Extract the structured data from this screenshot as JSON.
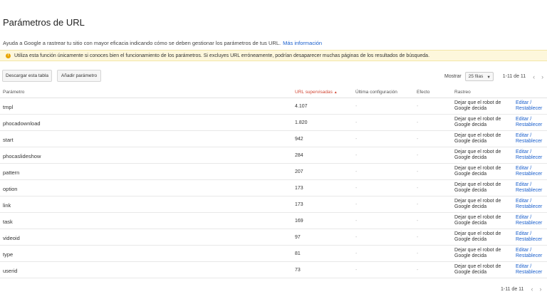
{
  "page": {
    "title": "Parámetros de URL",
    "intro": "Ayuda a Google a rastrear tu sitio con mayor eficacia indicando cómo se deben gestionar los parámetros de tus URL.",
    "more_info": "Más información",
    "warning": "Utiliza esta función únicamente si conoces bien el funcionamiento de los parámetros. Si excluyes URL erróneamente, podrían desaparecer muchas páginas de los resultados de búsqueda.",
    "warning_icon": "info-icon"
  },
  "toolbar": {
    "download_label": "Descargar esta tabla",
    "add_label": "Añadir parámetro",
    "show_label": "Mostrar",
    "rows_select": "25 filas",
    "range": "1-11 de 11"
  },
  "table": {
    "headers": {
      "param": "Parámetro",
      "urls": "URL supervisadas",
      "sort_indicator": "▲",
      "config": "Última configuración",
      "effect": "Efecto",
      "track": "Rastreo"
    },
    "rows": [
      {
        "param": "tmpl",
        "urls": "4.107",
        "config": "-",
        "effect": "-",
        "track": "Dejar que el robot de Google decida",
        "action": "Editar / Restablecer"
      },
      {
        "param": "phocadownload",
        "urls": "1.820",
        "config": "-",
        "effect": "-",
        "track": "Dejar que el robot de Google decida",
        "action": "Editar / Restablecer"
      },
      {
        "param": "start",
        "urls": "942",
        "config": "-",
        "effect": "-",
        "track": "Dejar que el robot de Google decida",
        "action": "Editar / Restablecer"
      },
      {
        "param": "phocaslideshow",
        "urls": "284",
        "config": "-",
        "effect": "-",
        "track": "Dejar que el robot de Google decida",
        "action": "Editar / Restablecer"
      },
      {
        "param": "pattern",
        "urls": "207",
        "config": "-",
        "effect": "-",
        "track": "Dejar que el robot de Google decida",
        "action": "Editar / Restablecer"
      },
      {
        "param": "option",
        "urls": "173",
        "config": "-",
        "effect": "-",
        "track": "Dejar que el robot de Google decida",
        "action": "Editar / Restablecer"
      },
      {
        "param": "link",
        "urls": "173",
        "config": "-",
        "effect": "-",
        "track": "Dejar que el robot de Google decida",
        "action": "Editar / Restablecer"
      },
      {
        "param": "task",
        "urls": "169",
        "config": "-",
        "effect": "-",
        "track": "Dejar que el robot de Google decida",
        "action": "Editar / Restablecer"
      },
      {
        "param": "videoid",
        "urls": "97",
        "config": "-",
        "effect": "-",
        "track": "Dejar que el robot de Google decida",
        "action": "Editar / Restablecer"
      },
      {
        "param": "type",
        "urls": "81",
        "config": "-",
        "effect": "-",
        "track": "Dejar que el robot de Google decida",
        "action": "Editar / Restablecer"
      },
      {
        "param": "userid",
        "urls": "73",
        "config": "-",
        "effect": "-",
        "track": "Dejar que el robot de Google decida",
        "action": "Editar / Restablecer"
      }
    ]
  },
  "colors": {
    "link": "#1a5fcc",
    "sorted_header": "#d14836",
    "warning_bg": "#fdf7dc",
    "warning_icon": "#e8a400"
  }
}
